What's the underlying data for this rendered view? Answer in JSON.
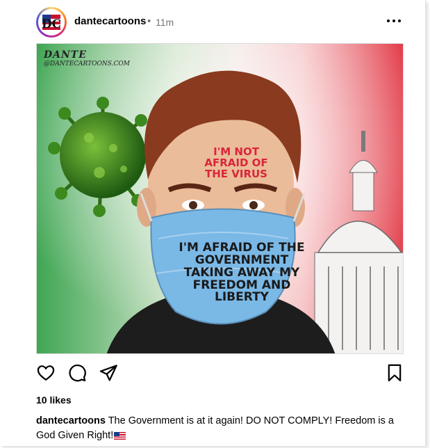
{
  "post": {
    "username": "dantecartoons",
    "separator": "•",
    "time_ago": "11m",
    "likes_text": "10 likes",
    "caption": {
      "username": "dantecartoons",
      "text": "The Government is at it again! DO NOT COMPLY! Freedom is a God Given Right!"
    }
  },
  "image": {
    "signature_name": "DANTE",
    "signature_handle": "@DANTECARTOONS.COM",
    "forehead_text": "I'M NOT AFRAID OF THE VIRUS",
    "mask_text": "I'M AFRAID OF THE GOVERNMENT TAKING AWAY MY FREEDOM AND LIBERTY"
  },
  "icons": {
    "more": "more-options-icon",
    "like": "heart-icon",
    "comment": "comment-icon",
    "share": "paper-plane-icon",
    "save": "bookmark-icon",
    "flag": "us-flag-emoji"
  },
  "colors": {
    "accent_red": "#d8263a",
    "secondary_text": "#737373"
  }
}
